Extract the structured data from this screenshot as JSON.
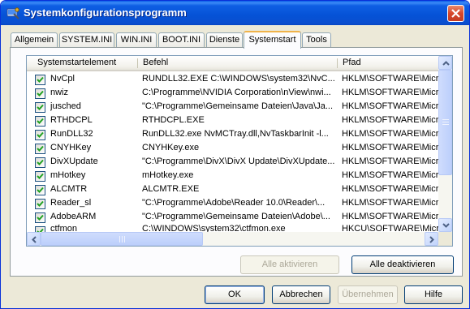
{
  "window": {
    "title": "Systemkonfigurationsprogramm"
  },
  "tabs": [
    {
      "label": "Allgemein"
    },
    {
      "label": "SYSTEM.INI"
    },
    {
      "label": "WIN.INI"
    },
    {
      "label": "BOOT.INI"
    },
    {
      "label": "Dienste"
    },
    {
      "label": "Systemstart",
      "active": true
    },
    {
      "label": "Tools"
    }
  ],
  "columns": {
    "name": "Systemstartelement",
    "command": "Befehl",
    "path": "Pfad"
  },
  "rows": [
    {
      "checked": true,
      "name": "NvCpl",
      "command": "RUNDLL32.EXE C:\\WINDOWS\\system32\\NvC...",
      "path": "HKLM\\SOFTWARE\\Microsof"
    },
    {
      "checked": true,
      "name": "nwiz",
      "command": "C:\\Programme\\NVIDIA Corporation\\nView\\nwi...",
      "path": "HKLM\\SOFTWARE\\Microsof"
    },
    {
      "checked": true,
      "name": "jusched",
      "command": "\"C:\\Programme\\Gemeinsame Dateien\\Java\\Ja...",
      "path": "HKLM\\SOFTWARE\\Microsof"
    },
    {
      "checked": true,
      "name": "RTHDCPL",
      "command": "RTHDCPL.EXE",
      "path": "HKLM\\SOFTWARE\\Microsof"
    },
    {
      "checked": true,
      "name": "RunDLL32",
      "command": "RunDLL32.exe NvMCTray.dll,NvTaskbarInit -l...",
      "path": "HKLM\\SOFTWARE\\Microsof"
    },
    {
      "checked": true,
      "name": "CNYHKey",
      "command": "CNYHKey.exe",
      "path": "HKLM\\SOFTWARE\\Microsof"
    },
    {
      "checked": true,
      "name": "DivXUpdate",
      "command": "\"C:\\Programme\\DivX\\DivX Update\\DivXUpdate...",
      "path": "HKLM\\SOFTWARE\\Microsof"
    },
    {
      "checked": true,
      "name": "mHotkey",
      "command": "mHotkey.exe",
      "path": "HKLM\\SOFTWARE\\Microsof"
    },
    {
      "checked": true,
      "name": "ALCMTR",
      "command": "ALCMTR.EXE",
      "path": "HKLM\\SOFTWARE\\Microsof"
    },
    {
      "checked": true,
      "name": "Reader_sl",
      "command": "\"C:\\Programme\\Adobe\\Reader 10.0\\Reader\\...",
      "path": "HKLM\\SOFTWARE\\Microsof"
    },
    {
      "checked": true,
      "name": "AdobeARM",
      "command": "\"C:\\Programme\\Gemeinsame Dateien\\Adobe\\...",
      "path": "HKLM\\SOFTWARE\\Microsof"
    },
    {
      "checked": true,
      "name": "ctfmon",
      "command": "C:\\WINDOWS\\system32\\ctfmon.exe",
      "path": "HKCU\\SOFTWARE\\Microsof"
    }
  ],
  "panel_buttons": {
    "enable_all": "Alle aktivieren",
    "disable_all": "Alle deaktivieren"
  },
  "dialog_buttons": {
    "ok": "OK",
    "cancel": "Abbrechen",
    "apply": "Übernehmen",
    "help": "Hilfe"
  },
  "colors": {
    "titlebar": "#0552d6",
    "checkbox_border": "#1c5180",
    "check_mark": "#21a121",
    "active_tab_accent": "#f0b34a"
  }
}
